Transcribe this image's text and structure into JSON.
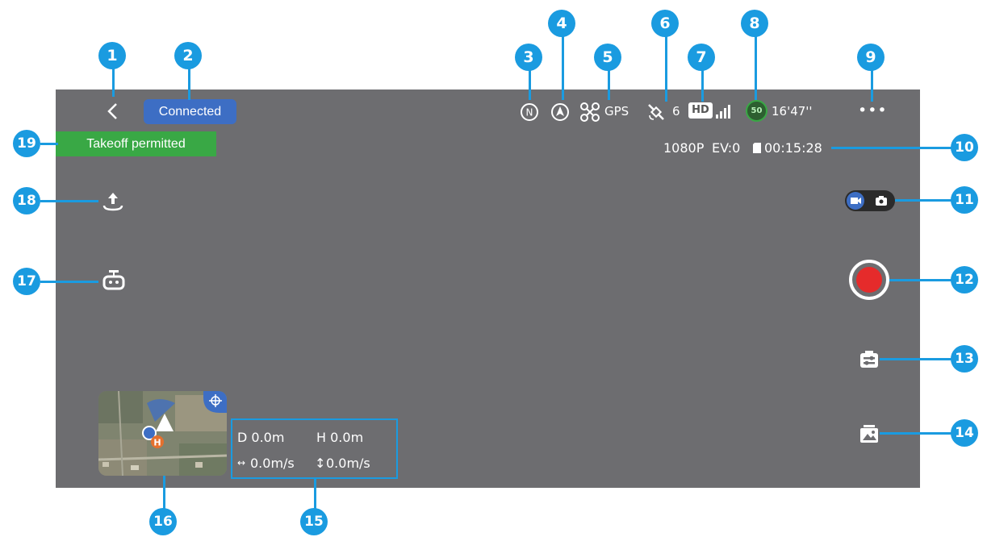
{
  "status": {
    "connection": "Connected",
    "takeoff": "Takeoff permitted",
    "gps_label": "GPS",
    "satellites": "6",
    "hd_label": "HD",
    "battery_percent": "50",
    "flight_time": "16'47''",
    "more_label": "•••"
  },
  "camera": {
    "resolution": "1080P",
    "ev": "EV:0",
    "remaining_time": "00:15:28"
  },
  "telemetry": {
    "distance": "D 0.0m",
    "height": "H 0.0m",
    "horizontal_speed": "0.0m/s",
    "vertical_speed": "0.0m/s"
  },
  "callouts": [
    "1",
    "2",
    "3",
    "4",
    "5",
    "6",
    "7",
    "8",
    "9",
    "10",
    "11",
    "12",
    "13",
    "14",
    "15",
    "16",
    "17",
    "18",
    "19"
  ],
  "colors": {
    "screen_bg": "#6d6d70",
    "callout": "#1a9be0",
    "connected_badge": "#3d6ec4",
    "takeoff_badge": "#39a845",
    "record": "#e52b2b"
  },
  "icons": {
    "back": "chevron-left-icon",
    "compass": "north-compass-icon",
    "navigation": "navigation-arrow-icon",
    "drone": "drone-icon",
    "satellite": "satellite-icon",
    "signal": "signal-bars-icon",
    "battery": "battery-icon",
    "sd_card": "sd-card-icon",
    "takeoff": "takeoff-icon",
    "drone_front": "drone-front-icon",
    "mode_toggle": "video-photo-toggle-icon",
    "record": "record-button-icon",
    "camera_settings": "camera-settings-icon",
    "gallery": "gallery-icon",
    "minimap": "minimap-icon"
  }
}
